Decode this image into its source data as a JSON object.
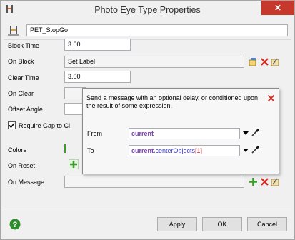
{
  "window": {
    "title": "Photo Eye Type Properties",
    "close_glyph": "✕"
  },
  "object": {
    "name": "PET_StopGo"
  },
  "properties": {
    "block_time_label": "Block Time",
    "block_time_value": "3.00",
    "on_block_label": "On Block",
    "on_block_value": "Set Label",
    "clear_time_label": "Clear Time",
    "clear_time_value": "3.00",
    "on_clear_label": "On Clear",
    "offset_angle_label": "Offset Angle",
    "require_gap_label": "Require Gap to Cl",
    "colors_label": "Colors",
    "on_reset_label": "On Reset",
    "on_message_label": "On Message"
  },
  "popup": {
    "description": "Send a message with an optional delay, or conditioned upon the result of some expression.",
    "from_label": "From",
    "from_value": "current",
    "to_label": "To",
    "to_value_kw": "current.",
    "to_value_rest": "centerObjects",
    "to_value_index": "[1]"
  },
  "buttons": {
    "apply": "Apply",
    "ok": "OK",
    "cancel": "Cancel"
  },
  "colors": {
    "close_red": "#c7382c",
    "add_green": "#3a9a2a",
    "delete_red": "#d9281e",
    "help_green": "#2e8b2e"
  }
}
